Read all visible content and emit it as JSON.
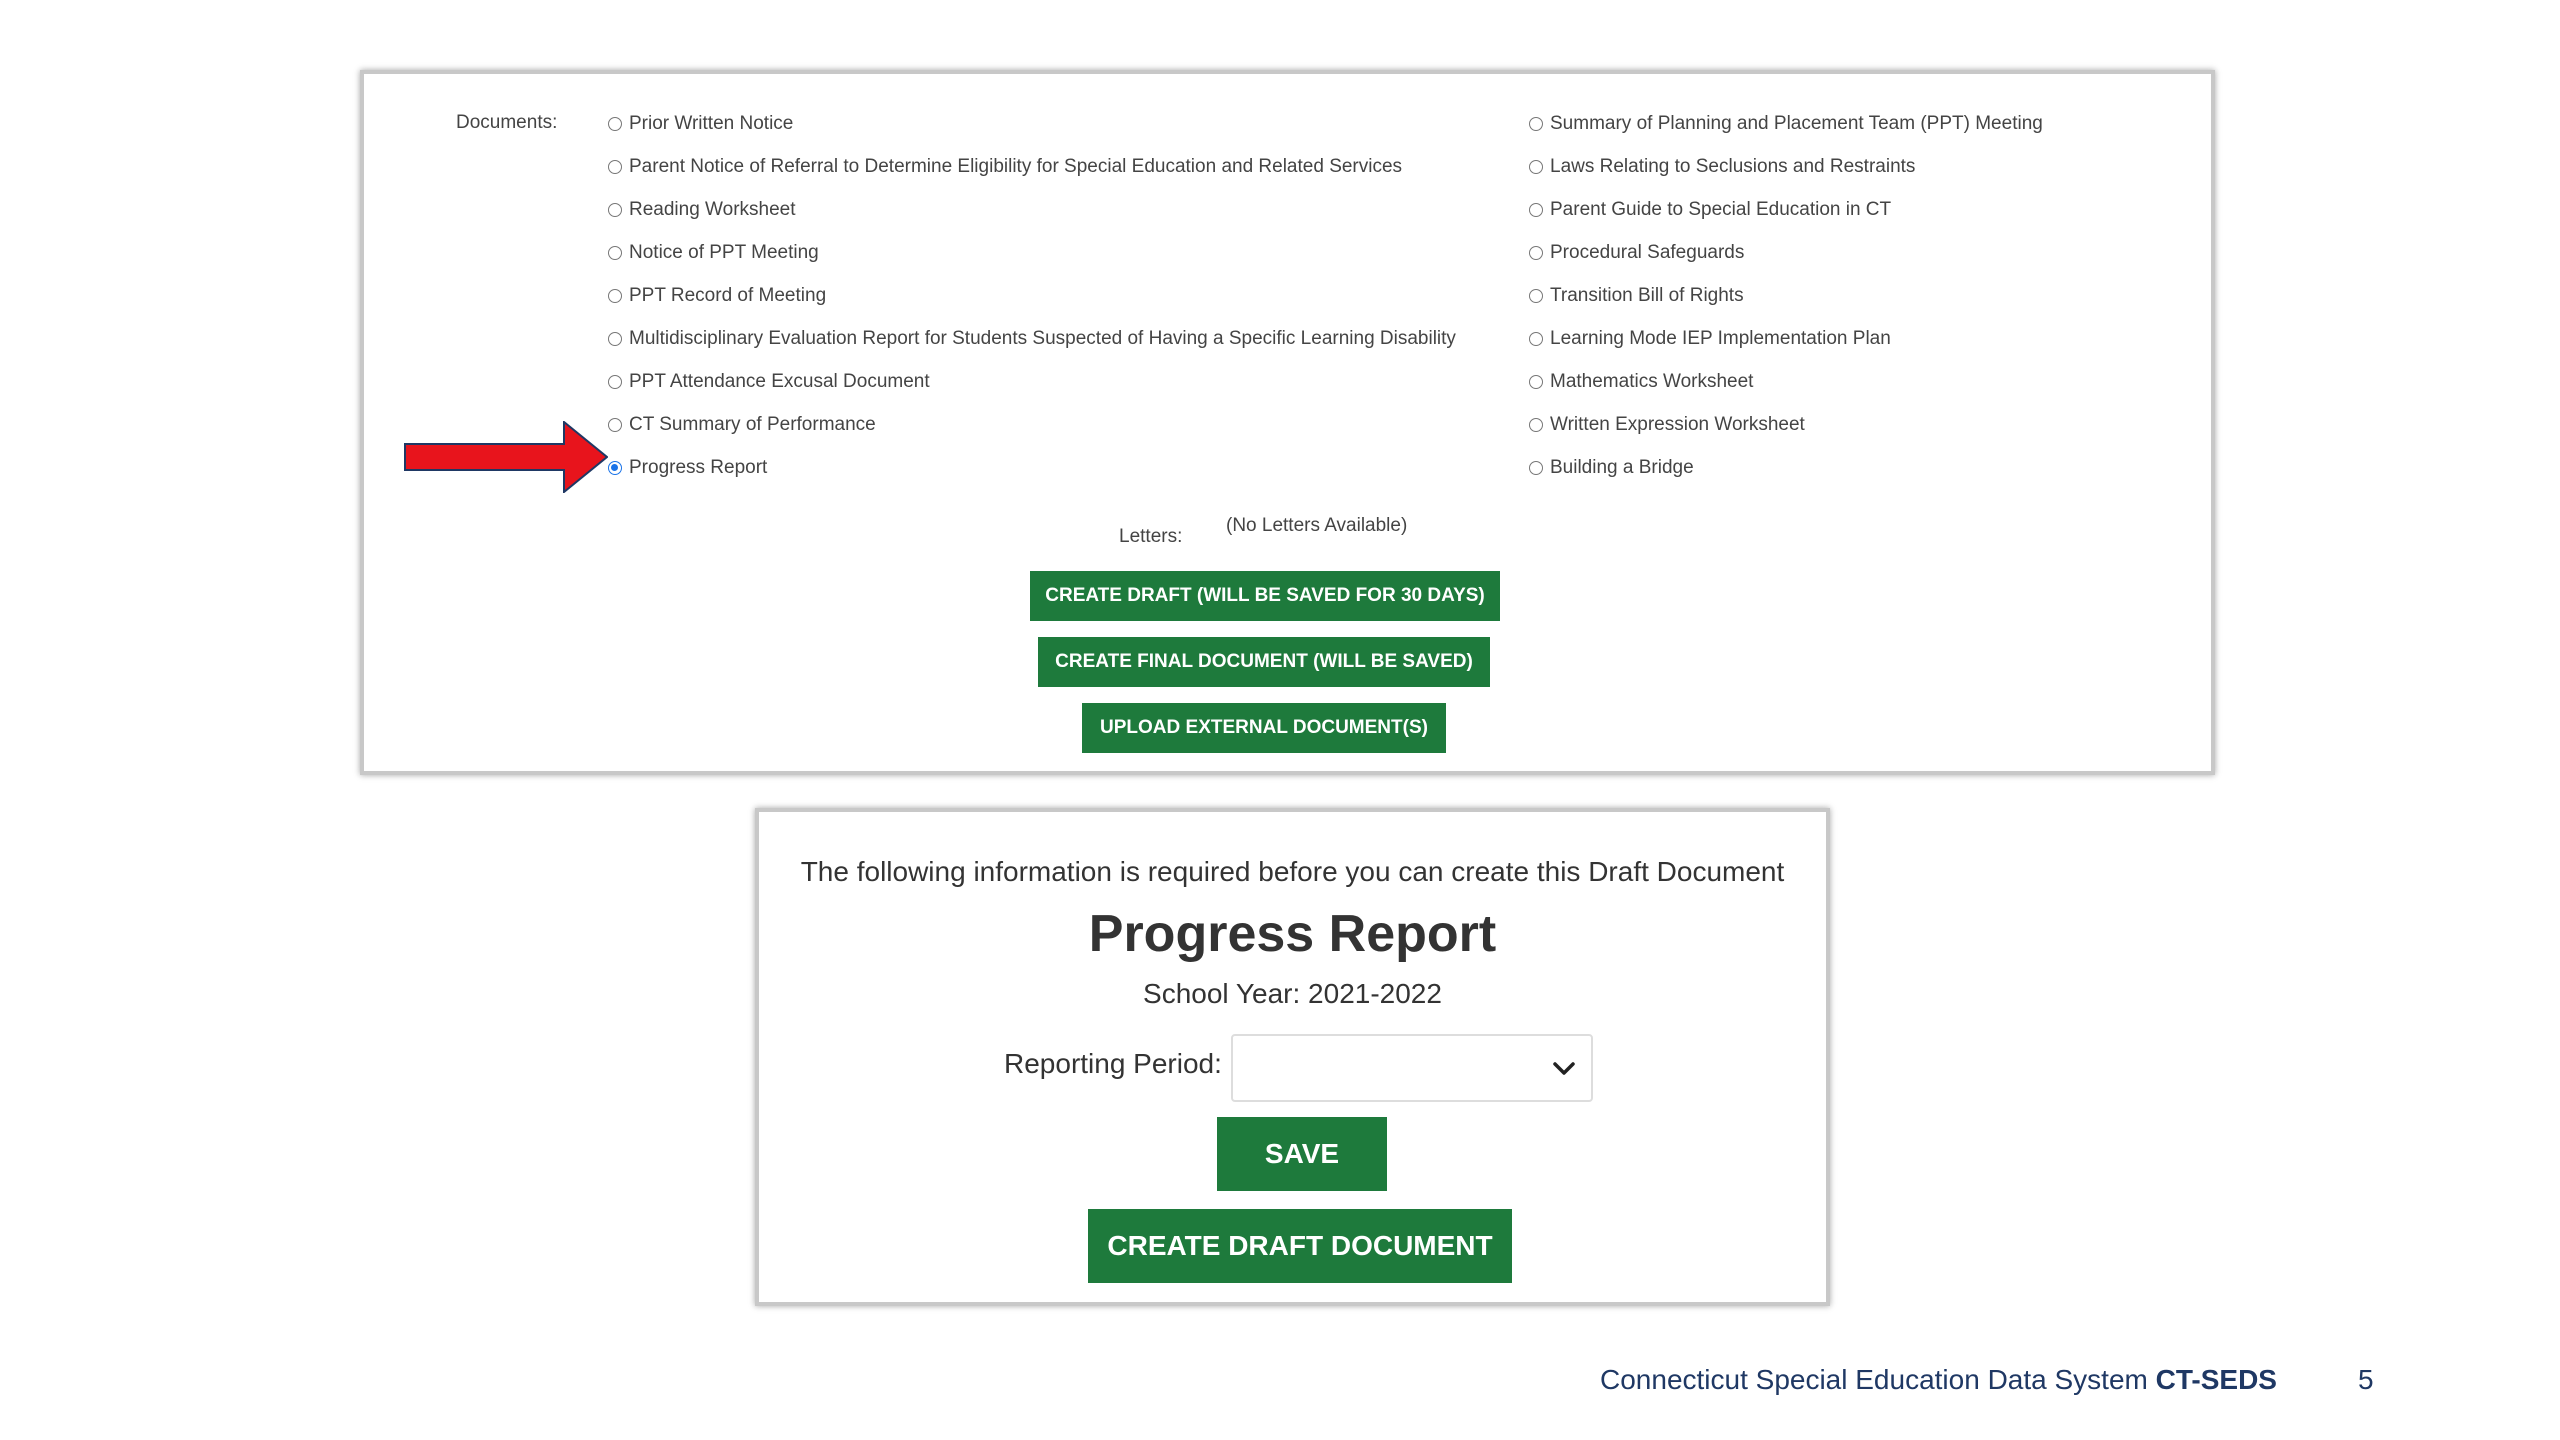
{
  "documents": {
    "label": "Documents:",
    "left_column": [
      {
        "label": "Prior Written Notice",
        "checked": false
      },
      {
        "label": "Parent Notice of Referral to Determine Eligibility for Special Education and Related Services",
        "checked": false
      },
      {
        "label": "Reading Worksheet",
        "checked": false
      },
      {
        "label": "Notice of PPT Meeting",
        "checked": false
      },
      {
        "label": "PPT Record of Meeting",
        "checked": false
      },
      {
        "label": "Multidisciplinary Evaluation Report for Students Suspected of Having a Specific Learning Disability",
        "checked": false
      },
      {
        "label": "PPT Attendance Excusal Document",
        "checked": false
      },
      {
        "label": "CT Summary of Performance",
        "checked": false
      },
      {
        "label": "Progress Report",
        "checked": true
      }
    ],
    "right_column": [
      {
        "label": "Summary of Planning and Placement Team (PPT) Meeting",
        "checked": false
      },
      {
        "label": "Laws Relating to Seclusions and Restraints",
        "checked": false
      },
      {
        "label": "Parent Guide to Special Education in CT",
        "checked": false
      },
      {
        "label": "Procedural Safeguards",
        "checked": false
      },
      {
        "label": "Transition Bill of Rights",
        "checked": false
      },
      {
        "label": "Learning Mode IEP Implementation Plan",
        "checked": false
      },
      {
        "label": "Mathematics Worksheet",
        "checked": false
      },
      {
        "label": "Written Expression Worksheet",
        "checked": false
      },
      {
        "label": "Building a Bridge",
        "checked": false
      }
    ]
  },
  "letters": {
    "label": "Letters:",
    "value": "(No Letters Available)"
  },
  "top_buttons": {
    "create_draft": "CREATE DRAFT (WILL BE SAVED FOR 30 DAYS)",
    "create_final": "CREATE FINAL DOCUMENT (WILL BE SAVED)",
    "upload_external": "UPLOAD EXTERNAL DOCUMENT(S)"
  },
  "draft_form": {
    "intro": "The following information is required before you can create this Draft Document",
    "title": "Progress Report",
    "school_year": "School Year: 2021-2022",
    "reporting_period_label": "Reporting Period:",
    "reporting_period_value": "",
    "save_button": "SAVE",
    "create_draft_button": "CREATE DRAFT DOCUMENT"
  },
  "footer": {
    "text": "Connecticut Special Education Data System ",
    "brand": "CT-SEDS",
    "page_number": "5"
  },
  "colors": {
    "button_green": "#1e7a3c",
    "radio_selected": "#1a73e8",
    "arrow_red": "#e8141c",
    "footer_blue": "#1f3864"
  },
  "icons": {
    "arrow": "red-arrow-icon",
    "dropdown": "chevron-down-icon"
  }
}
